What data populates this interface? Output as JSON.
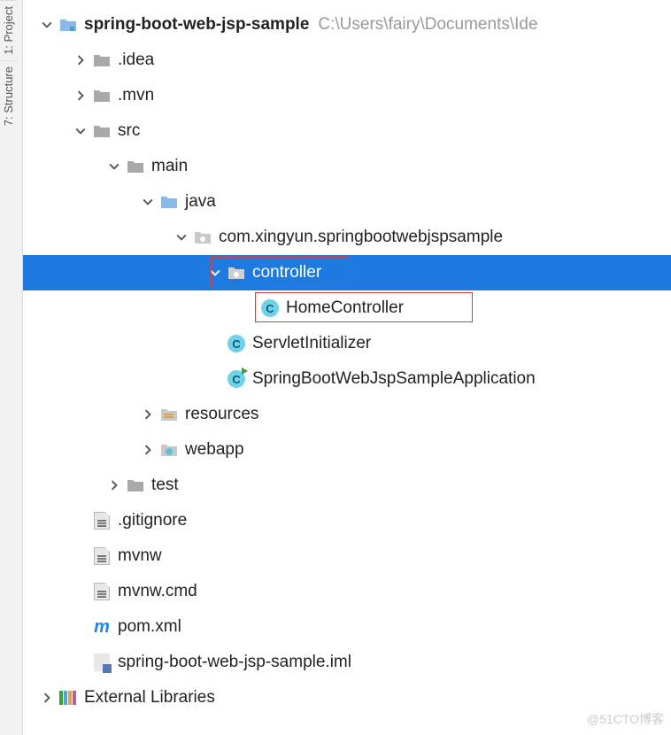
{
  "sidebar_tabs": {
    "project": "1: Project",
    "structure": "7: Structure"
  },
  "root": {
    "name": "spring-boot-web-jsp-sample",
    "path": "C:\\Users\\fairy\\Documents\\Ide"
  },
  "tree": {
    "idea": ".idea",
    "mvn": ".mvn",
    "src": "src",
    "main": "main",
    "java": "java",
    "package": "com.xingyun.springbootwebjspsample",
    "controller": "controller",
    "homectrl": "HomeController",
    "servlet": "ServletInitializer",
    "app": "SpringBootWebJspSampleApplication",
    "resources": "resources",
    "webapp": "webapp",
    "test": "test",
    "gitignore": ".gitignore",
    "mvnw": "mvnw",
    "mvnwcmd": "mvnw.cmd",
    "pom": "pom.xml",
    "iml": "spring-boot-web-jsp-sample.iml"
  },
  "external_libs": "External Libraries",
  "watermark": "@51CTO博客"
}
